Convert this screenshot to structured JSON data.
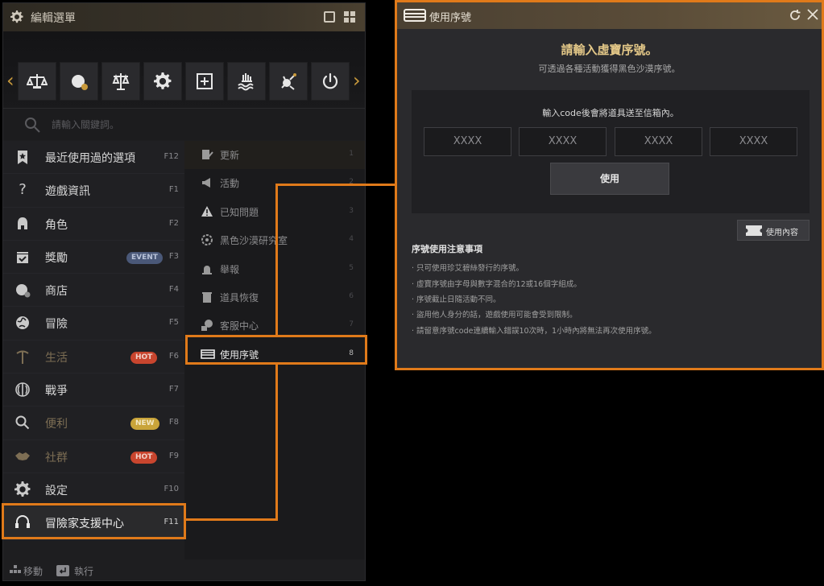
{
  "menu": {
    "title": "編輯選單",
    "search_placeholder": "請輸入關鍵詞。",
    "quick_icons": [
      "scales-book-icon",
      "shop-globe-icon",
      "justice-scales-icon",
      "gear-icon",
      "plus-box-icon",
      "hand-water-icon",
      "skill-node-icon",
      "power-icon"
    ],
    "left_items": [
      {
        "name": "recent",
        "label": "最近使用過的選項",
        "key": "F12",
        "icon": "bookmark-star-icon"
      },
      {
        "name": "game-info",
        "label": "遊戲資訊",
        "key": "F1",
        "icon": "question-icon"
      },
      {
        "name": "character",
        "label": "角色",
        "key": "F2",
        "icon": "helmet-icon"
      },
      {
        "name": "rewards",
        "label": "獎勵",
        "key": "F3",
        "badge": "EVENT",
        "icon": "gift-check-icon"
      },
      {
        "name": "shop",
        "label": "商店",
        "key": "F4",
        "icon": "shop-globe-icon"
      },
      {
        "name": "adventure",
        "label": "冒險",
        "key": "F5",
        "icon": "globe-icon"
      },
      {
        "name": "life",
        "label": "生活",
        "key": "F6",
        "badge": "HOT",
        "dim": true,
        "icon": "pickaxe-icon"
      },
      {
        "name": "war",
        "label": "戰爭",
        "key": "F7",
        "icon": "crest-icon"
      },
      {
        "name": "convenience",
        "label": "便利",
        "key": "F8",
        "badge": "NEW",
        "dim": true,
        "icon": "magnifier-icon"
      },
      {
        "name": "community",
        "label": "社群",
        "key": "F9",
        "badge": "HOT",
        "dim": true,
        "icon": "handshake-icon"
      },
      {
        "name": "settings",
        "label": "設定",
        "key": "F10",
        "icon": "gear-icon"
      },
      {
        "name": "support",
        "label": "冒險家支援中心",
        "key": "F11",
        "icon": "headset-icon"
      }
    ],
    "right_items": [
      {
        "name": "update",
        "label": "更新",
        "num": "1",
        "icon": "notepad-pen-icon"
      },
      {
        "name": "event",
        "label": "活動",
        "num": "2",
        "icon": "megaphone-icon"
      },
      {
        "name": "known-issues",
        "label": "已知問題",
        "num": "3",
        "icon": "warning-icon"
      },
      {
        "name": "lab",
        "label": "黑色沙漠研究室",
        "num": "4",
        "icon": "gear-eye-icon"
      },
      {
        "name": "report",
        "label": "舉報",
        "num": "5",
        "icon": "siren-icon"
      },
      {
        "name": "item-restore",
        "label": "道具恢復",
        "num": "6",
        "icon": "trash-restore-icon"
      },
      {
        "name": "service-center",
        "label": "客服中心",
        "num": "7",
        "icon": "chat-help-icon"
      },
      {
        "name": "coupon",
        "label": "使用序號",
        "num": "8",
        "icon": "ticket-icon"
      }
    ],
    "footer": {
      "move": "移動",
      "execute": "執行"
    }
  },
  "panel": {
    "title": "使用序號",
    "heading": "請輸入虛寶序號。",
    "subheading": "可透過各種活動獲得黑色沙漠序號。",
    "instruction": "輸入code後會將道具送至信箱內。",
    "code_placeholders": [
      "XXXX",
      "XXXX",
      "XXXX",
      "XXXX"
    ],
    "use_button": "使用",
    "usage_button": "使用內容",
    "notes_title": "序號使用注意事項",
    "notes": [
      "· 只可使用珍艾碧絲發行的序號。",
      "· 虛寶序號由字母與數字混合的12或16個字組成。",
      "· 序號截止日隨活動不同。",
      "· 盜用他人身分的話，遊戲使用可能會受到限制。",
      "· 請留意序號code連續輸入錯誤10次時，1小時內將無法再次使用序號。"
    ]
  },
  "colors": {
    "accent": "#e07a1a",
    "gold": "#e4c888",
    "hot": "#c8452e",
    "new": "#c9a43a",
    "event": "#4a5878"
  }
}
